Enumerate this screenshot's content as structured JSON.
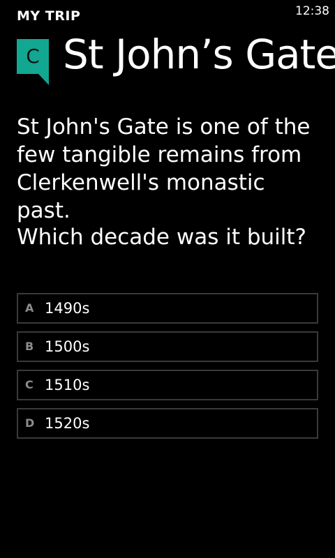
{
  "status_bar": {
    "time": "12:38"
  },
  "app": {
    "title": "MY TRIP"
  },
  "header": {
    "badge_letter": "C",
    "title": "St John’s Gate",
    "accent_color": "#12a791"
  },
  "question": {
    "intro": "St John's Gate is one of the few tangible remains from Clerkenwell's monastic past.",
    "prompt": "Which decade was it built?"
  },
  "answers": [
    {
      "letter": "A",
      "text": "1490s"
    },
    {
      "letter": "B",
      "text": "1500s"
    },
    {
      "letter": "C",
      "text": "1510s"
    },
    {
      "letter": "D",
      "text": "1520s"
    }
  ]
}
